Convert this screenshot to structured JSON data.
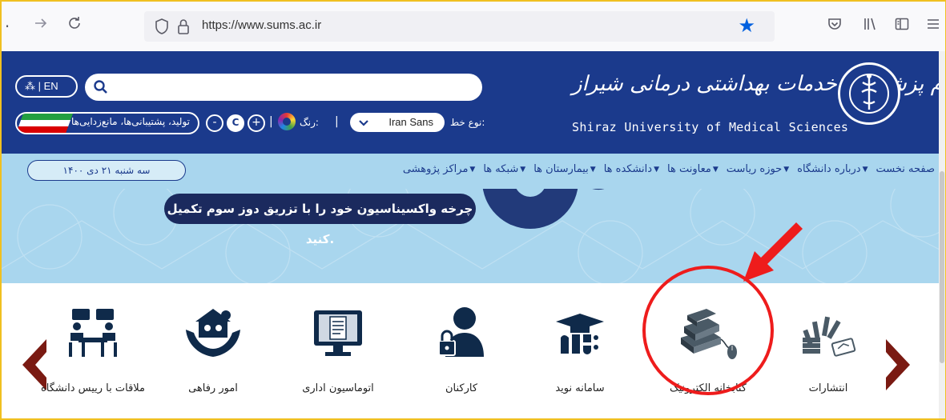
{
  "browser": {
    "url": "https://www.sums.ac.ir",
    "icons": [
      "back-icon",
      "forward-icon",
      "reload-icon",
      "shield-icon",
      "lock-icon",
      "bookmark-star-icon",
      "pocket-icon",
      "library-icon",
      "sidebar-icon",
      "menu-icon"
    ]
  },
  "header": {
    "lang_label": "| EN",
    "search_placeholder": "",
    "pills_label": "تولید، پشتیبانی‌ها، مانع‌زدایی‌ها",
    "color_label": "رنگ:",
    "font_label": "نوع خط:",
    "font_value": "Iran Sans",
    "zoom_minus": "-",
    "zoom_plus": "+",
    "logo_fa": "دانشگاه علوم پزشکی و خدمات بهداشتی درمانی شیراز",
    "logo_en": "Shiraz University of Medical Sciences"
  },
  "nav": {
    "date": "سه شنبه ۲۱ دی ۱۴۰۰",
    "items": [
      {
        "label": "صفحه نخست",
        "has_menu": false
      },
      {
        "label": "درباره دانشگاه",
        "has_menu": true
      },
      {
        "label": "حوزه ریاست",
        "has_menu": true
      },
      {
        "label": "معاونت ها",
        "has_menu": true
      },
      {
        "label": "دانشکده ها",
        "has_menu": true
      },
      {
        "label": "بیمارستان ها",
        "has_menu": true
      },
      {
        "label": "شبکه ها",
        "has_menu": true
      },
      {
        "label": "مراکز پژوهشی",
        "has_menu": true
      }
    ]
  },
  "banner": {
    "text": "چرخه واکسیناسیون خود را با تزریق دوز سوم تکمیل کنید."
  },
  "services": {
    "items": [
      {
        "label": "ملاقات با رییس دانشگاه",
        "icon": "meeting-icon"
      },
      {
        "label": "امور رفاهی",
        "icon": "welfare-icon"
      },
      {
        "label": "اتوماسیون اداری",
        "icon": "office-automation-icon"
      },
      {
        "label": "کارکنان",
        "icon": "staff-icon"
      },
      {
        "label": "سامانه نوید",
        "icon": "navid-system-icon"
      },
      {
        "label": "کتابخانه الکترونیک",
        "icon": "electronic-library-icon"
      },
      {
        "label": "انتشارات",
        "icon": "publications-icon"
      }
    ]
  },
  "colors": {
    "header_bg": "#1b3a8c",
    "nav_bg": "#a9d6ee",
    "highlight": "#ee1c1c",
    "arrow": "#7a1a12"
  }
}
